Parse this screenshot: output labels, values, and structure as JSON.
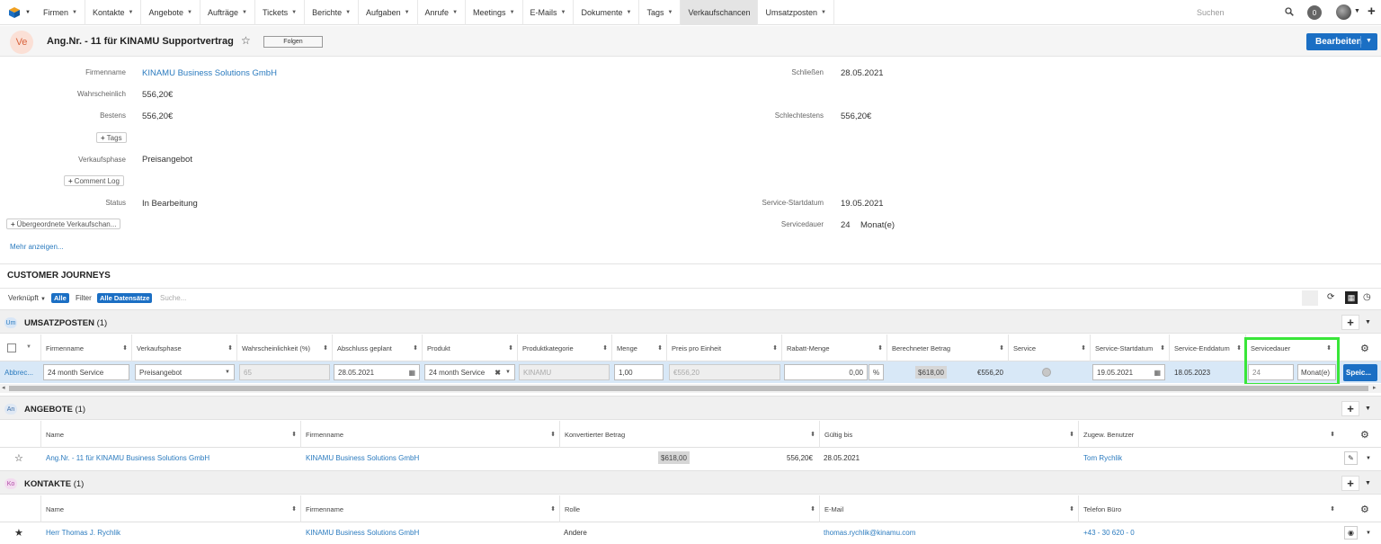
{
  "nav": {
    "items": [
      {
        "label": "Firmen",
        "caret": true,
        "w": 52
      },
      {
        "label": "Kontakte",
        "caret": true,
        "w": 60
      },
      {
        "label": "Angebote",
        "caret": true,
        "w": 64
      },
      {
        "label": "Aufträge",
        "caret": true,
        "w": 58
      },
      {
        "label": "Tickets",
        "caret": true,
        "w": 54
      },
      {
        "label": "Berichte",
        "caret": true,
        "w": 56
      },
      {
        "label": "Aufgaben",
        "caret": true,
        "w": 63
      },
      {
        "label": "Anrufe",
        "caret": true,
        "w": 54
      },
      {
        "label": "Meetings",
        "caret": true,
        "w": 61
      },
      {
        "label": "E-Mails",
        "caret": true,
        "w": 55
      },
      {
        "label": "Dokumente",
        "caret": true,
        "w": 71
      },
      {
        "label": "Tags",
        "caret": true,
        "w": 43
      },
      {
        "label": "Verkaufschancen",
        "caret": false,
        "w": 90,
        "active": true
      },
      {
        "label": "Umsatzposten",
        "caret": true,
        "w": 82
      }
    ],
    "search_placeholder": "Suchen",
    "notification_count": "0"
  },
  "header": {
    "avatar_text": "Ve",
    "title": "Ang.Nr. - 11 für KINAMU Supportvertrag",
    "follow_label": "Folgen",
    "edit_label": "Bearbeiten"
  },
  "fields": {
    "firmenname_label": "Firmenname",
    "firmenname_value": "KINAMU Business Solutions GmbH",
    "wahrscheinlich_label": "Wahrscheinlich",
    "wahrscheinlich_value": "556,20€",
    "bestens_label": "Bestens",
    "bestens_value": "556,20€",
    "tags_label": "Tags",
    "verkaufsphase_label": "Verkaufsphase",
    "verkaufsphase_value": "Preisangebot",
    "comment_log_label": "Comment Log",
    "status_label": "Status",
    "status_value": "In Bearbeitung",
    "parent_label": "Übergeordnete Verkaufschan...",
    "more_label": "Mehr anzeigen...",
    "schliessen_label": "Schließen",
    "schliessen_value": "28.05.2021",
    "schlechtestens_label": "Schlechtestens",
    "schlechtestens_value": "556,20€",
    "service_start_label": "Service-Startdatum",
    "service_start_value": "19.05.2021",
    "servicedauer_label": "Servicedauer",
    "servicedauer_value": "24",
    "servicedauer_unit": "Monat(e)"
  },
  "cj": {
    "title": "CUSTOMER JOURNEYS",
    "verknuepft_label": "Verknüpft",
    "alle_chip": "Alle",
    "filter_label": "Filter",
    "alle_datensaetze_chip": "Alle Datensätze",
    "search_placeholder": "Suche..."
  },
  "umsatzposten": {
    "icon": "Um",
    "title": "UMSATZPOSTEN",
    "count": "(1)",
    "columns": [
      {
        "label": "Firmenname"
      },
      {
        "label": "Verkaufsphase"
      },
      {
        "label": "Wahrscheinlichkeit (%)"
      },
      {
        "label": "Abschluss geplant"
      },
      {
        "label": "Produkt"
      },
      {
        "label": "Produktkategorie"
      },
      {
        "label": "Menge"
      },
      {
        "label": "Preis pro Einheit"
      },
      {
        "label": "Rabatt-Menge"
      },
      {
        "label": "Berechneter Betrag"
      },
      {
        "label": "Service"
      },
      {
        "label": "Service-Startdatum"
      },
      {
        "label": "Service-Enddatum"
      },
      {
        "label": "Servicedauer"
      }
    ],
    "row": {
      "action_label": "Abbrec...",
      "firmenname": "24 month Service",
      "verkaufsphase": "Preisangebot",
      "wahrscheinlichkeit": "65",
      "abschluss": "28.05.2021",
      "produkt": "24 month Service",
      "produktkategorie": "KINAMU",
      "menge": "1,00",
      "preis": "€556,20",
      "rabatt": "0,00",
      "rabatt_unit": "%",
      "berechnet_orig": "$618,00",
      "berechnet": "€556,20",
      "service_start": "19.05.2021",
      "service_end": "18.05.2023",
      "servicedauer": "24",
      "servicedauer_unit": "Monat(e)",
      "save_label": "Speic..."
    }
  },
  "angebote": {
    "icon": "An",
    "title": "ANGEBOTE",
    "count": "(1)",
    "columns": [
      {
        "label": "Name"
      },
      {
        "label": "Firmenname"
      },
      {
        "label": "Konvertierter Betrag"
      },
      {
        "label": "Gültig bis"
      },
      {
        "label": "Zugew. Benutzer"
      }
    ],
    "row": {
      "name": "Ang.Nr. - 11 für KINAMU Business Solutions GmbH",
      "firmenname": "KINAMU Business Solutions GmbH",
      "betrag_orig": "$618,00",
      "betrag": "556,20€",
      "gueltig": "28.05.2021",
      "benutzer": "Tom Rychlik"
    }
  },
  "kontakte": {
    "icon": "Ko",
    "title": "KONTAKTE",
    "count": "(1)",
    "columns": [
      {
        "label": "Name"
      },
      {
        "label": "Firmenname"
      },
      {
        "label": "Rolle"
      },
      {
        "label": "E-Mail"
      },
      {
        "label": "Telefon Büro"
      }
    ],
    "row": {
      "name": "Herr Thomas J. Rychlik",
      "firmenname": "KINAMU Business Solutions GmbH",
      "rolle": "Andere",
      "email": "thomas.rychlik@kinamu.com",
      "telefon": "+43 - 30 620 - 0"
    }
  }
}
